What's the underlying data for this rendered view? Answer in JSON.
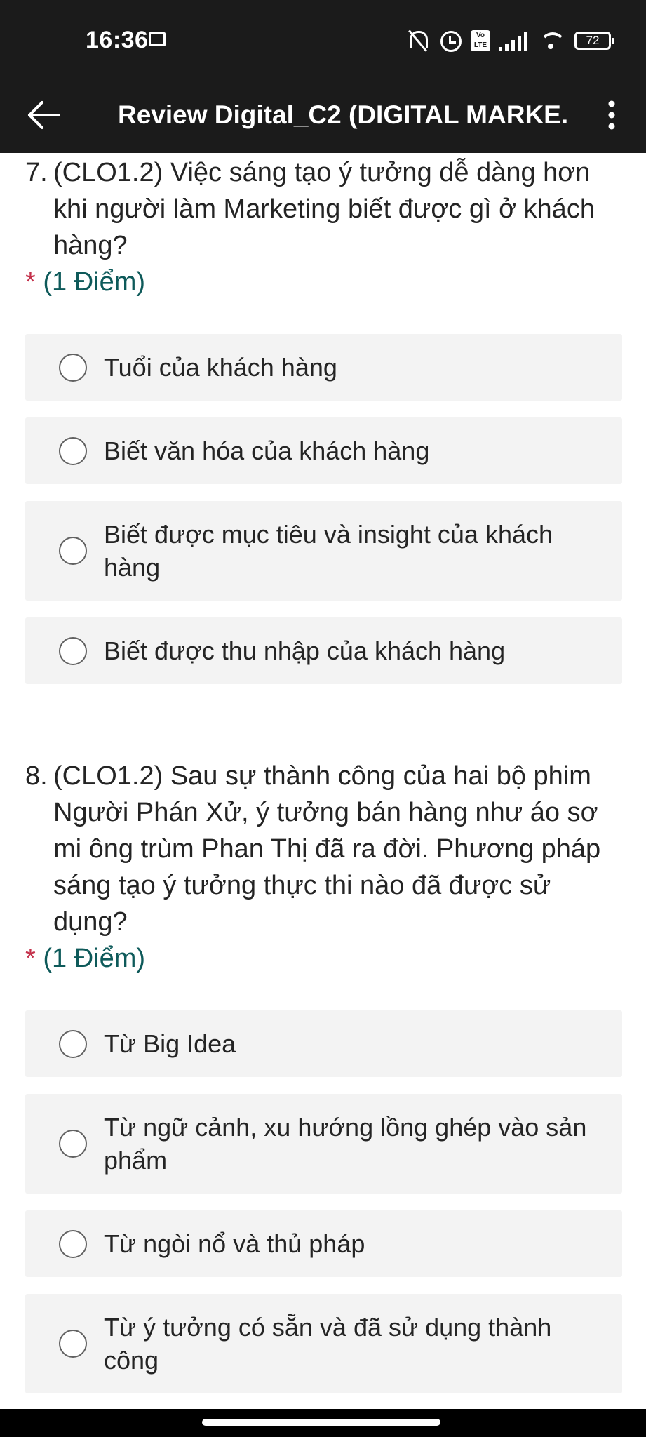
{
  "status_bar": {
    "time": "16:36",
    "volte_label": "Vo LTE",
    "battery_level": "72"
  },
  "app_bar": {
    "title": "Review Digital_C2 (DIGITAL MARKE..."
  },
  "questions": [
    {
      "number": "7.",
      "text": "(CLO1.2) Việc sáng tạo ý tưởng dễ dàng hơn khi người làm Marketing biết được gì ở khách hàng?",
      "required_mark": "*",
      "points": "(1 Điểm)",
      "options": [
        "Tuổi của khách hàng",
        "Biết văn hóa của khách hàng",
        "Biết được mục tiêu và insight của khách hàng",
        "Biết được thu nhập của khách hàng"
      ]
    },
    {
      "number": "8.",
      "text": "(CLO1.2) Sau sự thành công của hai bộ phim Người Phán Xử, ý tưởng bán hàng như áo sơ mi ông trùm Phan Thị đã ra đời. Phương pháp sáng tạo ý tưởng thực thi nào đã được sử dụng?",
      "required_mark": "*",
      "points": "(1 Điểm)",
      "options": [
        "Từ Big Idea",
        "Từ ngữ cảnh, xu hướng lồng ghép vào sản phẩm",
        "Từ ngòi nổ và thủ pháp",
        "Từ ý tưởng có sẵn và đã sử dụng thành công"
      ]
    }
  ]
}
